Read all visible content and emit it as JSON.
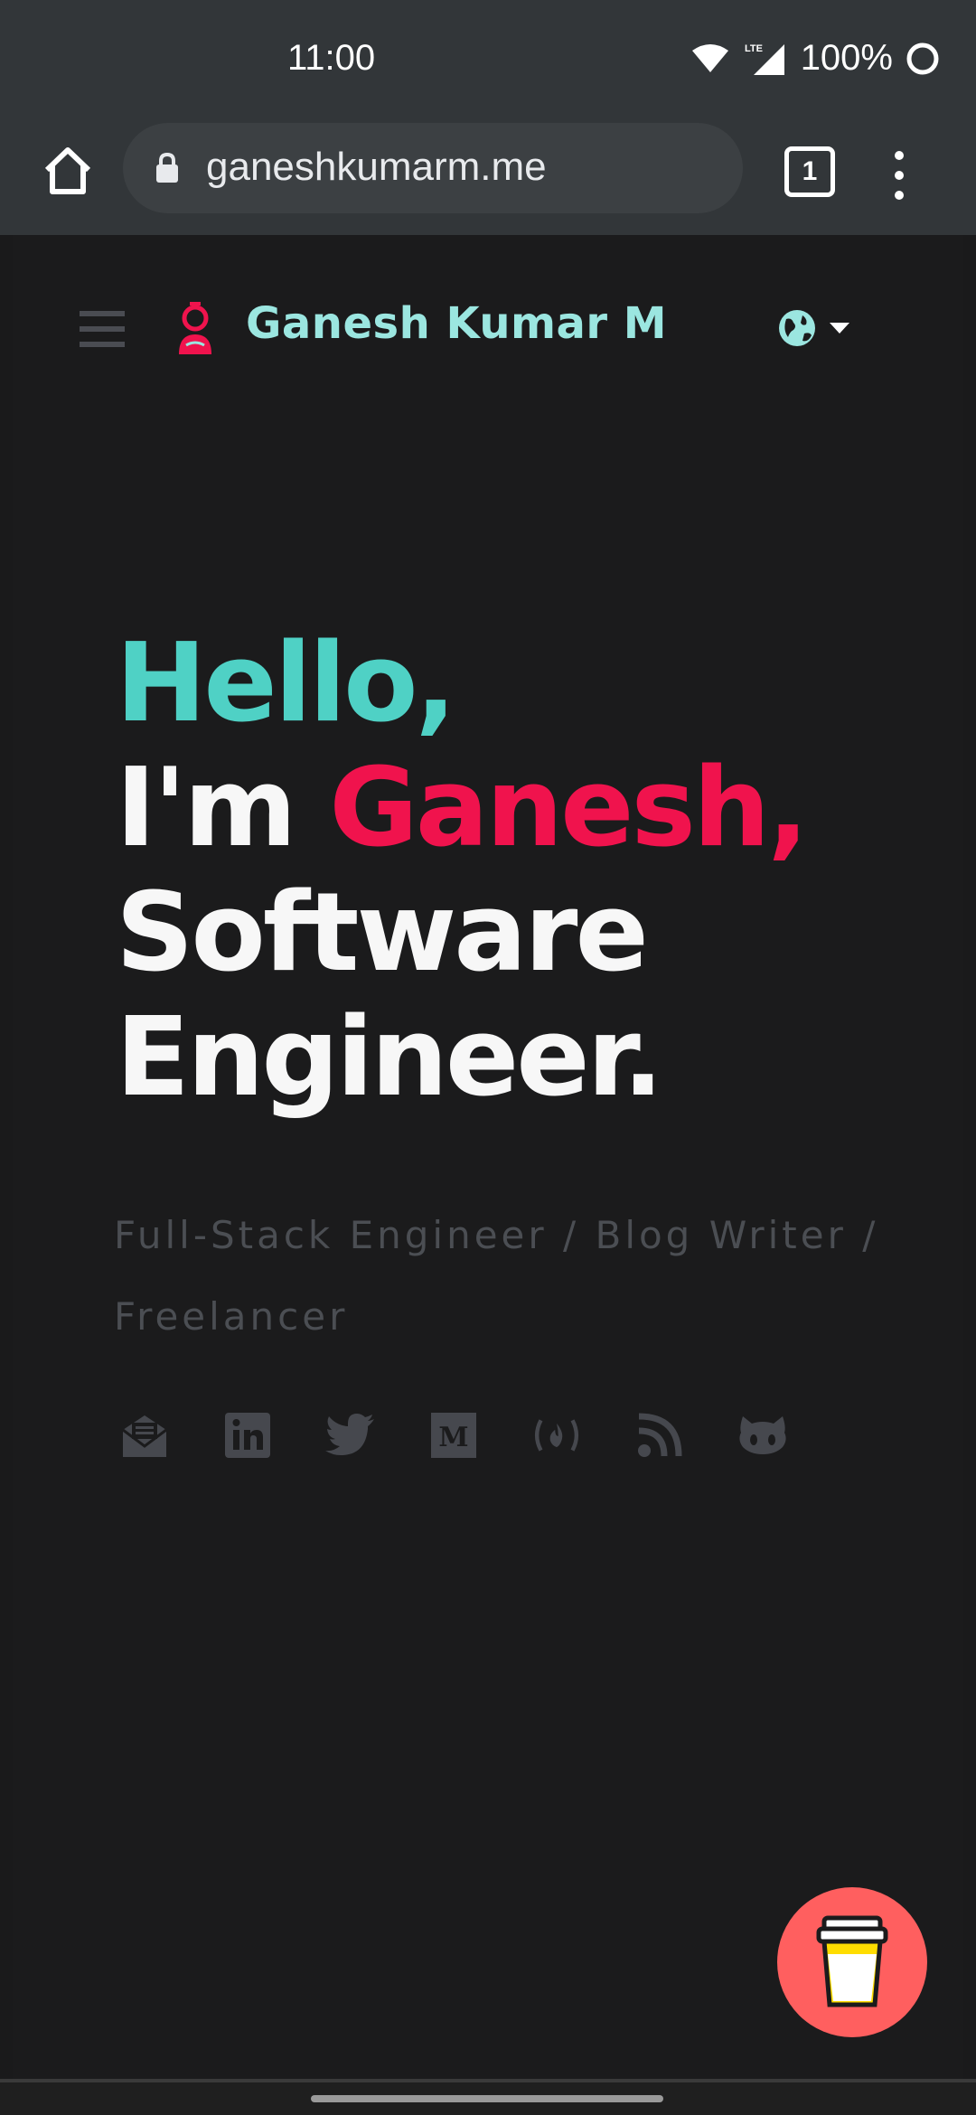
{
  "status_bar": {
    "time": "11:00",
    "network": "LTE",
    "battery": "100%"
  },
  "browser": {
    "url": "ganeshkumarm.me",
    "tab_count": "1"
  },
  "site": {
    "name": "Ganesh Kumar M",
    "hero": {
      "greeting": "Hello,",
      "intro": "I'm",
      "first_name": "Ganesh,",
      "role_line1": "Software",
      "role_line2": "Engineer."
    },
    "tagline": "Full-Stack Engineer / Blog Writer / Freelancer",
    "socials": [
      "email-icon",
      "linkedin-icon",
      "twitter-icon",
      "medium-icon",
      "freecodecamp-icon",
      "rss-icon",
      "github-icon"
    ]
  },
  "colors": {
    "accent_teal": "#4fd1c5",
    "accent_red": "#f0134d",
    "coffee_button": "#ff5f5f",
    "background": "#1b1b1c"
  }
}
